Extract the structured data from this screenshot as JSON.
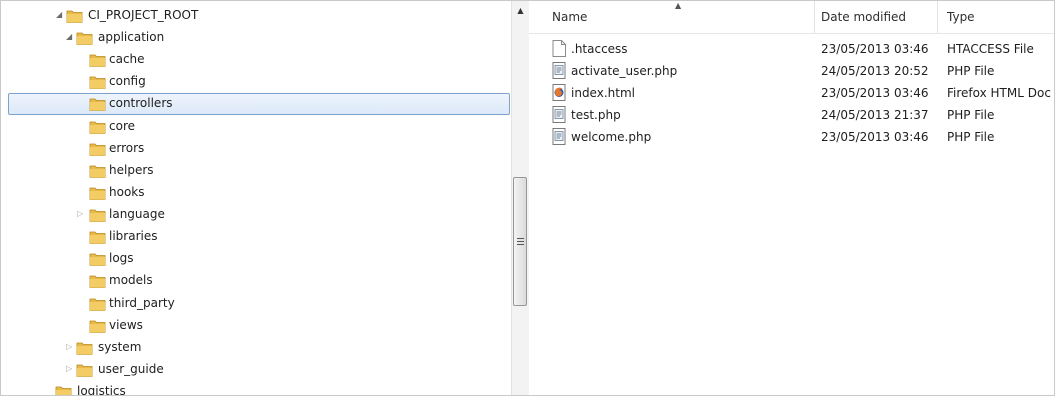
{
  "tree": {
    "root": {
      "label": "CI_PROJECT_ROOT"
    },
    "application": {
      "label": "application",
      "children": [
        {
          "label": "cache"
        },
        {
          "label": "config"
        },
        {
          "label": "controllers"
        },
        {
          "label": "core"
        },
        {
          "label": "errors"
        },
        {
          "label": "helpers"
        },
        {
          "label": "hooks"
        },
        {
          "label": "language"
        },
        {
          "label": "libraries"
        },
        {
          "label": "logs"
        },
        {
          "label": "models"
        },
        {
          "label": "third_party"
        },
        {
          "label": "views"
        }
      ]
    },
    "system": {
      "label": "system"
    },
    "user_guide": {
      "label": "user_guide"
    },
    "logistics": {
      "label": "logistics"
    },
    "selected": "controllers"
  },
  "list": {
    "columns": {
      "name": "Name",
      "date": "Date modified",
      "type": "Type"
    },
    "files": [
      {
        "name": ".htaccess",
        "date": "23/05/2013 03:46",
        "type": "HTACCESS File",
        "icon": "blank-file-icon"
      },
      {
        "name": "activate_user.php",
        "date": "24/05/2013 20:52",
        "type": "PHP File",
        "icon": "php-file-icon"
      },
      {
        "name": "index.html",
        "date": "23/05/2013 03:46",
        "type": "Firefox HTML Doc...",
        "icon": "firefox-html-icon"
      },
      {
        "name": "test.php",
        "date": "24/05/2013 21:37",
        "type": "PHP File",
        "icon": "php-file-icon"
      },
      {
        "name": "welcome.php",
        "date": "23/05/2013 03:46",
        "type": "PHP File",
        "icon": "php-file-icon"
      }
    ]
  },
  "colors": {
    "folder": "#e8b84a",
    "selection_border": "#7da2ce",
    "selection_fill": "#dce9f9"
  }
}
